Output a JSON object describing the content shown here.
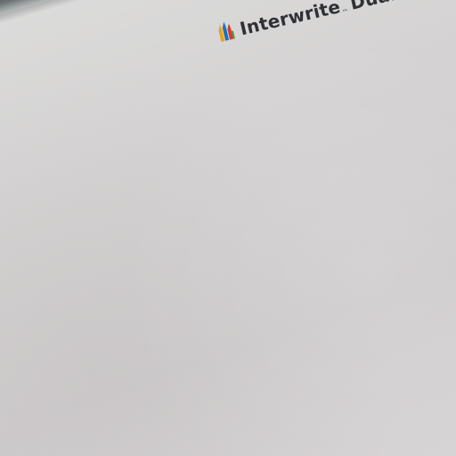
{
  "brand": {
    "name": "Interwrite",
    "trademark": "™",
    "product": "DualBo",
    "logo_icon": "colored-pencils-icon"
  },
  "colors": {
    "surface": "#d3d1d1",
    "frame": "#8e9796",
    "frame_accent": "#b9d9d2",
    "text": "#2f3134"
  }
}
